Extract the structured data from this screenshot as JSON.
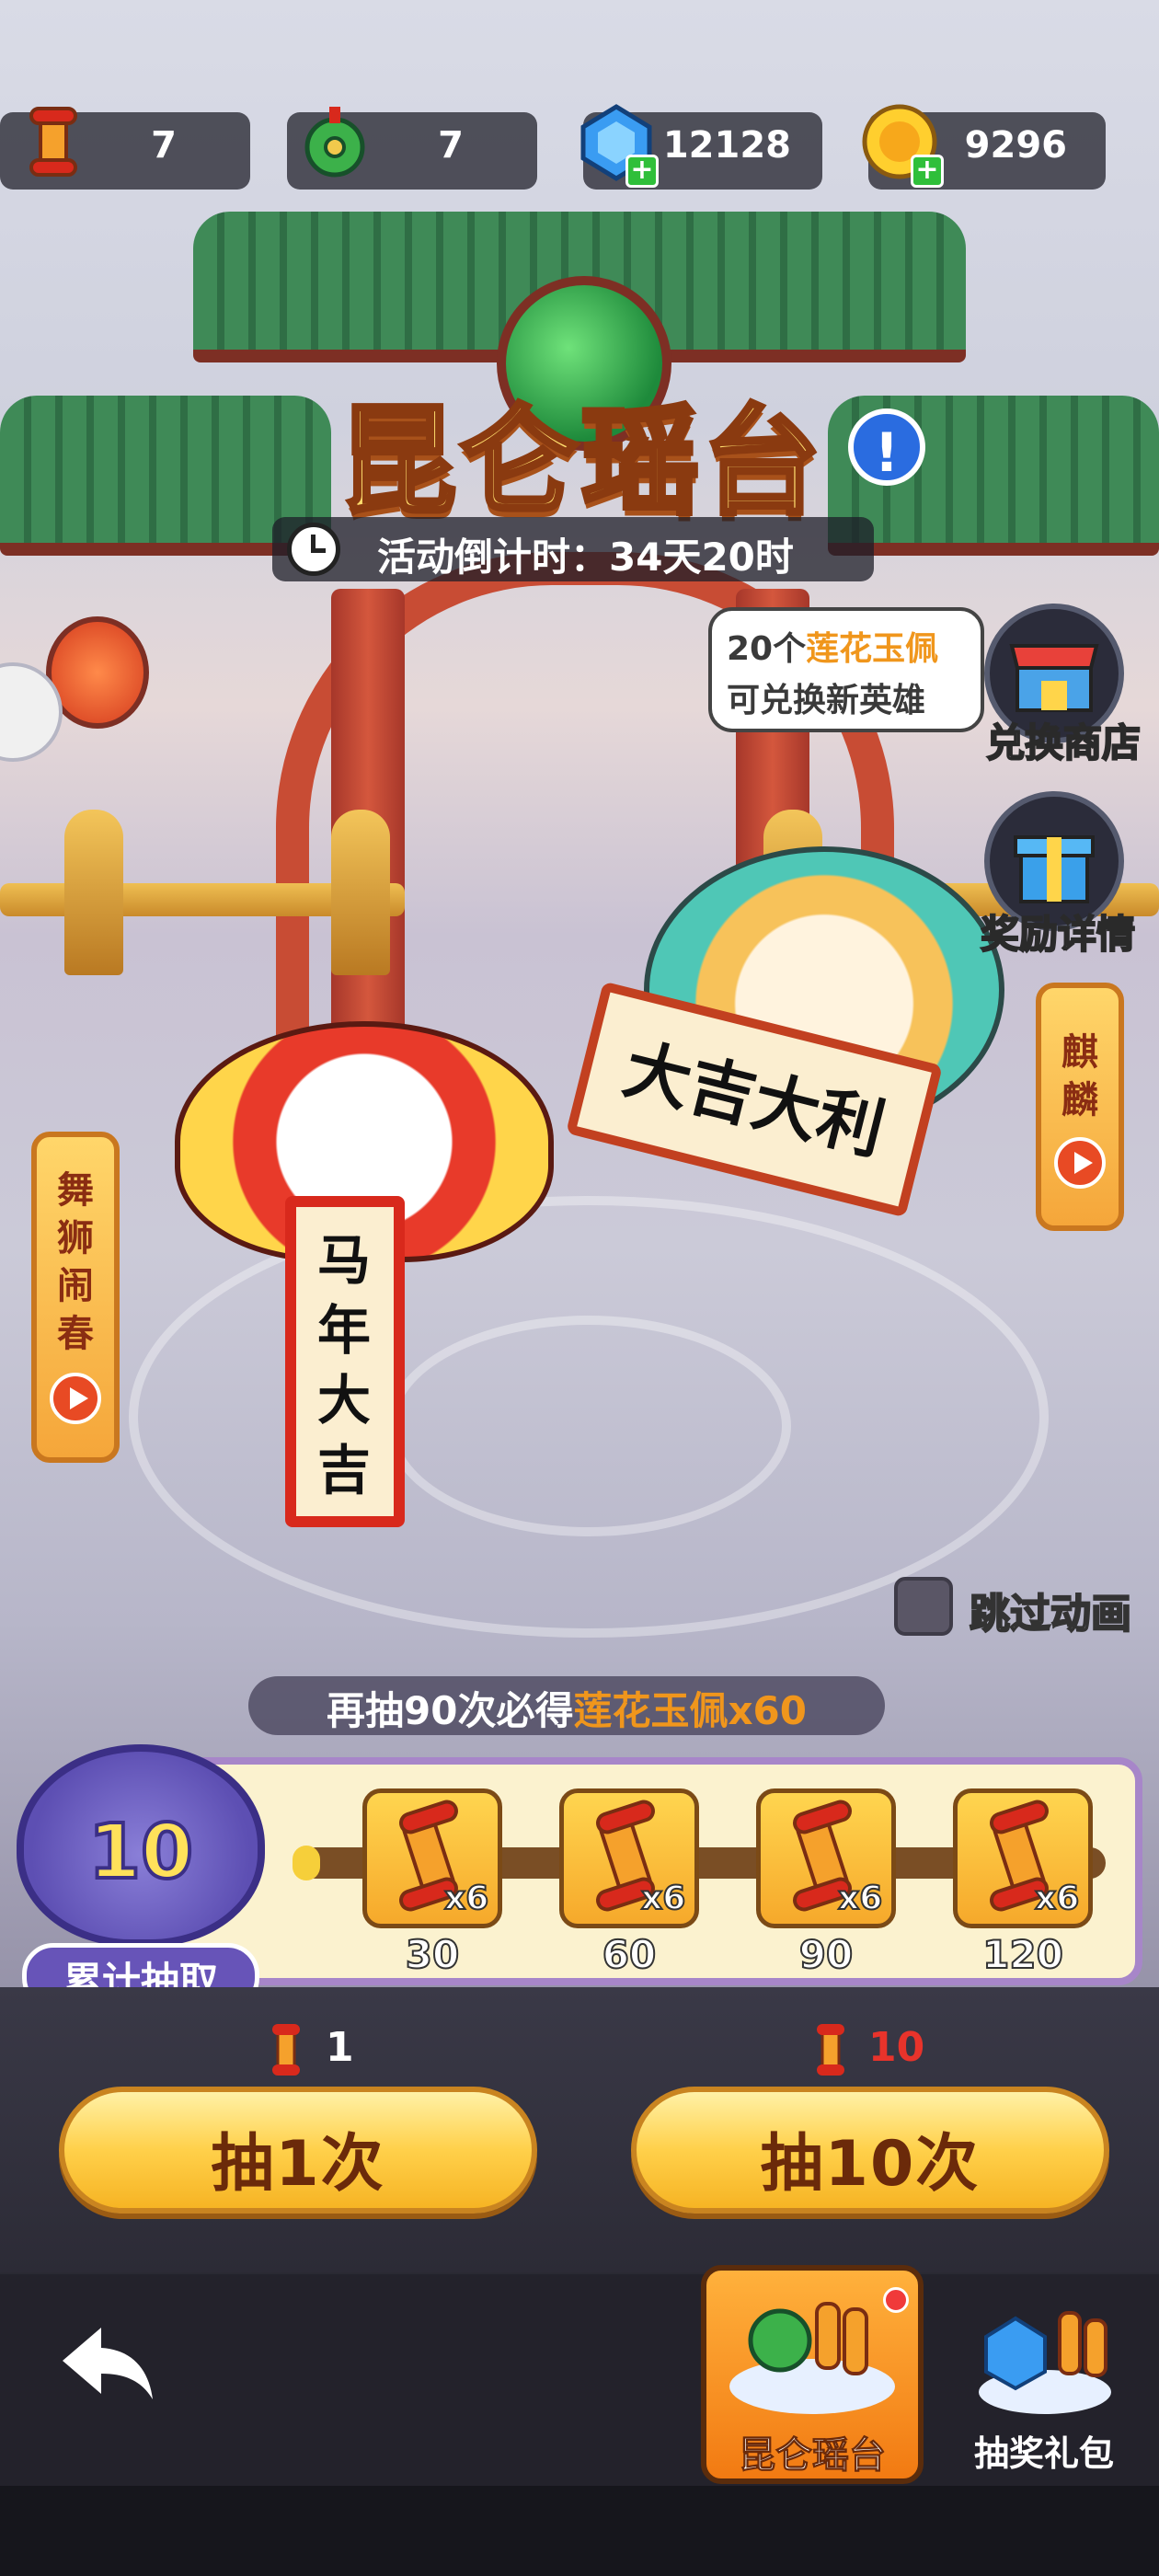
{
  "resources": [
    {
      "name": "draw-scroll",
      "icon": "scroll-icon",
      "value": "7"
    },
    {
      "name": "jade-pendant",
      "icon": "jade-pendant-icon",
      "value": "7"
    },
    {
      "name": "gem",
      "icon": "gem-icon",
      "value": "12128",
      "addable": true
    },
    {
      "name": "gold",
      "icon": "gold-coin-icon",
      "value": "9296",
      "addable": true
    }
  ],
  "header": {
    "title": "昆仑瑶台",
    "info_symbol": "!",
    "countdown": "活动倒计时：34天20时"
  },
  "bubble": {
    "line1_prefix": "20个",
    "line1_highlight": "莲花玉佩",
    "line2": "可兑换新英雄"
  },
  "side": {
    "shop_label": "兑换商店",
    "rewards_label": "奖励详情"
  },
  "tabs_vertical": {
    "left": "舞狮闹春",
    "right": "麒麟"
  },
  "scene": {
    "lion_scroll": "马年大吉",
    "qilin_banner": "大吉大利"
  },
  "skip": {
    "label": "跳过动画",
    "checked": false
  },
  "guarantee": {
    "prefix": "再抽90次必得",
    "highlight": "莲花玉佩x60"
  },
  "progress": {
    "count": "10",
    "label": "累计抽取",
    "fill_fraction": 0.0,
    "milestones": [
      {
        "qty": "x6",
        "mark": "30"
      },
      {
        "qty": "x6",
        "mark": "60"
      },
      {
        "qty": "x6",
        "mark": "90"
      },
      {
        "qty": "x6",
        "mark": "120"
      }
    ]
  },
  "draw": {
    "single": {
      "cost": "1",
      "label": "抽1次",
      "cost_color": "#ffffff"
    },
    "ten": {
      "cost": "10",
      "label": "抽10次",
      "cost_color": "#e8332b"
    }
  },
  "nav": {
    "active_tab": "昆仑瑶台",
    "other_tab": "抽奖礼包"
  },
  "colors": {
    "accent_orange": "#f0961c",
    "title_gold": "#ffdd6d",
    "button_gold": "#ffd04a"
  }
}
